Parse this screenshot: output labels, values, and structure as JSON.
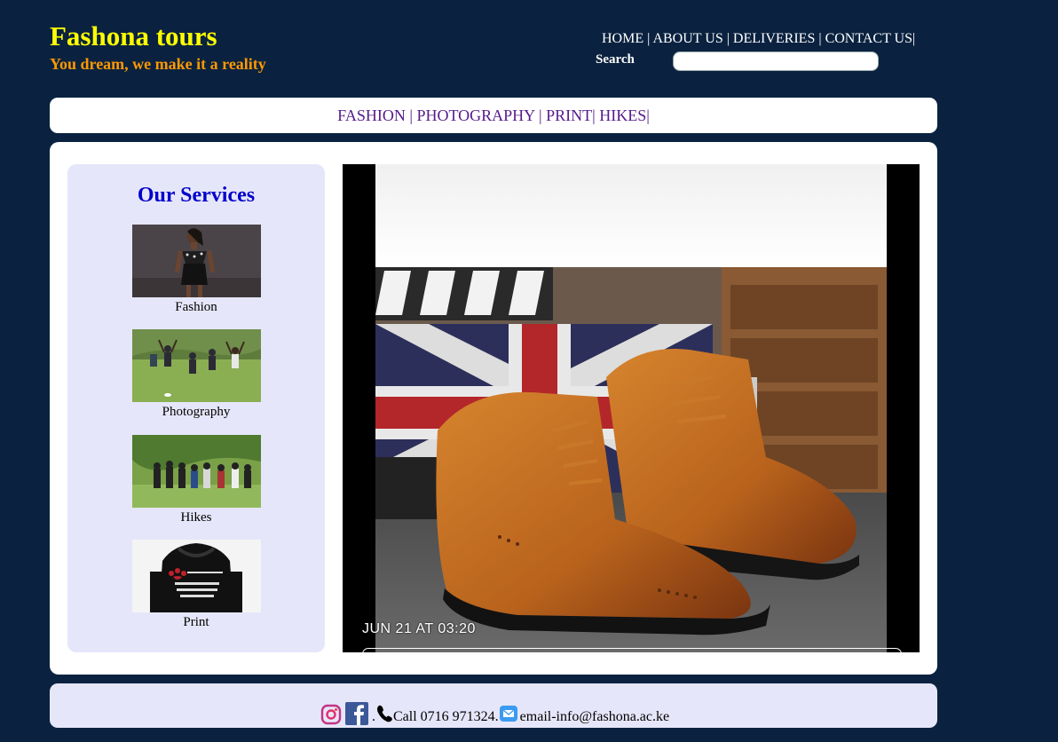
{
  "header": {
    "title": "Fashona tours",
    "tagline": "You dream, we make it a reality"
  },
  "topnav": {
    "home": "HOME",
    "about": "ABOUT US",
    "deliveries": "DELIVERIES",
    "contact": "CONTACT US"
  },
  "search": {
    "label": "Search",
    "value": "",
    "placeholder": ""
  },
  "catnav": {
    "fashion": "FASHION",
    "photography": "PHOTOGRAPHY",
    "print": "PRINT",
    "hikes": "HIKES"
  },
  "services": {
    "title": "Our Services",
    "items": [
      {
        "label": "Fashion"
      },
      {
        "label": "Photography"
      },
      {
        "label": "Hikes"
      },
      {
        "label": "Print"
      }
    ]
  },
  "slideshow": {
    "timestamp": "JUN 21 AT 03:20"
  },
  "footer": {
    "call": "Call 0716 971324.",
    "email": "email-info@fashona.ac.ke"
  },
  "colors": {
    "background": "#0a2240",
    "title": "#ffff00",
    "tagline": "#ff9900",
    "services_bg": "#e6e6fa",
    "services_title": "#0000cc",
    "link": "#551a8b"
  },
  "icons": [
    "instagram-icon",
    "facebook-icon",
    "phone-icon",
    "email-icon"
  ]
}
